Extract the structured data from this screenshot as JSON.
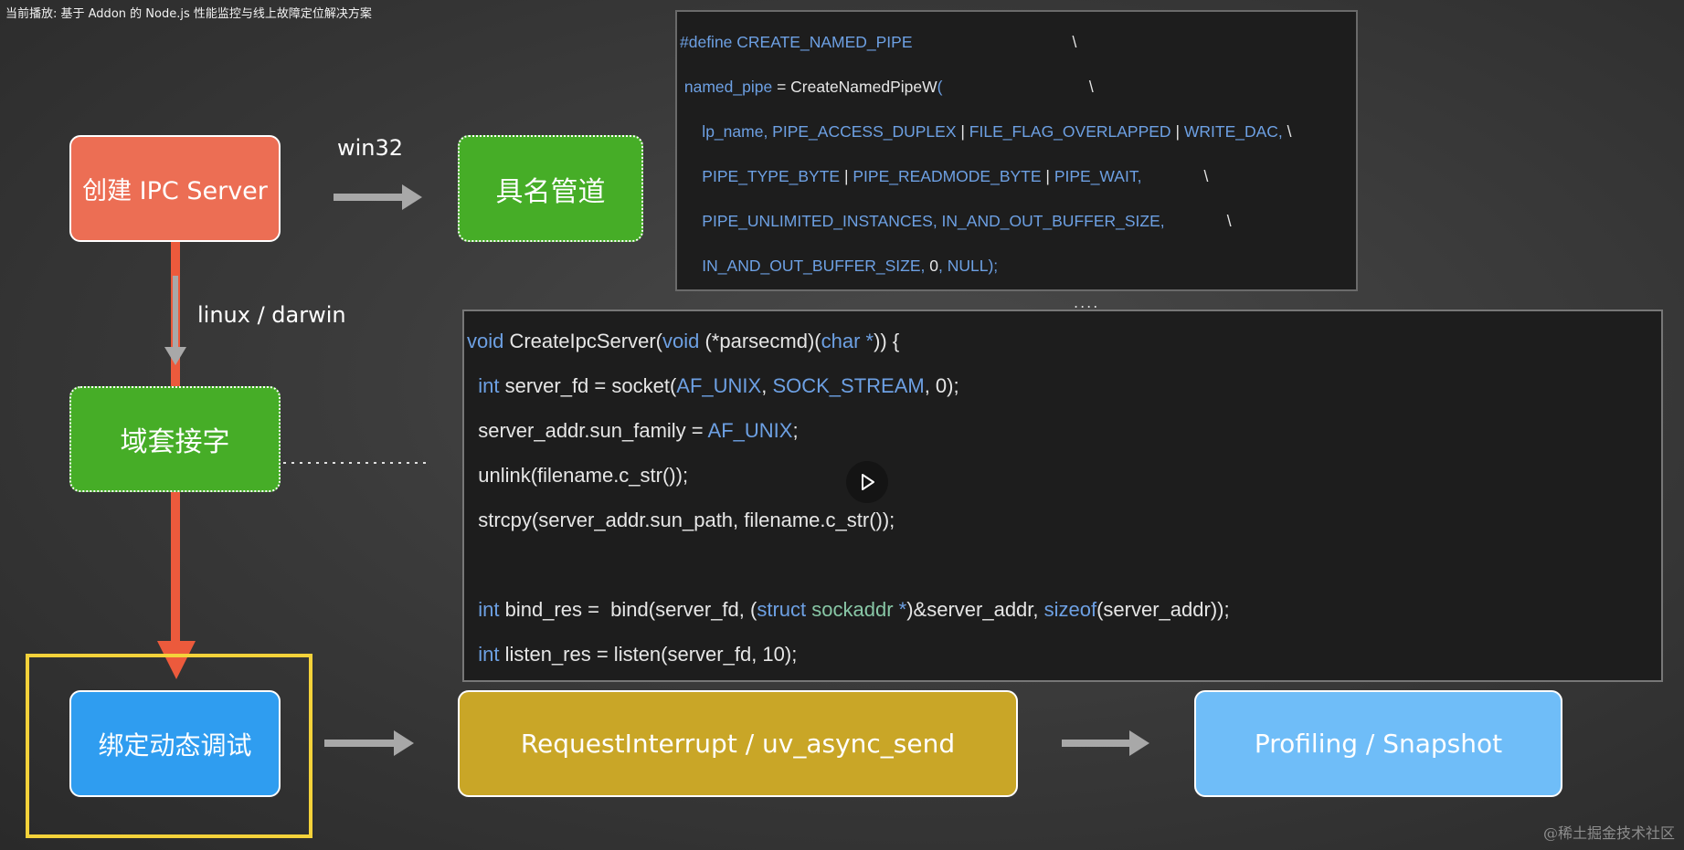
{
  "now_playing": "当前播放: 基于 Addon 的 Node.js 性能监控与线上故障定位解决方案",
  "watermark": "@稀土掘金技术社区",
  "flow": {
    "create_server": "创建 IPC Server",
    "named_pipe": "具名管道",
    "domain_socket": "域套接字",
    "bind_debug": "绑定动态调试",
    "request_interrupt": "RequestInterrupt / uv_async_send",
    "profiling": "Profiling / Snapshot",
    "label_win32": "win32",
    "label_linux": "linux / darwin"
  },
  "code_win": {
    "line1": [
      {
        "t": "#define ",
        "c": "kw"
      },
      {
        "t": "CREATE_NAMED_PIPE",
        "c": "kw"
      },
      {
        "t": "                                    \\",
        "c": "fn"
      }
    ],
    "line2": [
      {
        "t": " named_pipe",
        "c": "kw"
      },
      {
        "t": " = CreateNamedPipeW",
        "c": "fn"
      },
      {
        "t": "(",
        "c": "kw"
      },
      {
        "t": "                                 \\",
        "c": "fn"
      }
    ],
    "line3": [
      {
        "t": "     lp_name, PIPE_ACCESS_DUPLEX",
        "c": "kw"
      },
      {
        "t": " | ",
        "c": "fn"
      },
      {
        "t": "FILE_FLAG_OVERLAPPED",
        "c": "kw"
      },
      {
        "t": " | ",
        "c": "fn"
      },
      {
        "t": "WRITE_DAC,",
        "c": "kw"
      },
      {
        "t": " \\",
        "c": "fn"
      }
    ],
    "line4": [
      {
        "t": "     PIPE_TYPE_BYTE",
        "c": "kw"
      },
      {
        "t": " | ",
        "c": "fn"
      },
      {
        "t": "PIPE_READMODE_BYTE",
        "c": "kw"
      },
      {
        "t": " | ",
        "c": "fn"
      },
      {
        "t": "PIPE_WAIT,",
        "c": "kw"
      },
      {
        "t": "              \\",
        "c": "fn"
      }
    ],
    "line5": [
      {
        "t": "     PIPE_UNLIMITED_INSTANCES, IN_AND_OUT_BUFFER_SIZE,",
        "c": "kw"
      },
      {
        "t": "              \\",
        "c": "fn"
      }
    ],
    "line6": [
      {
        "t": "     IN_AND_OUT_BUFFER_SIZE, ",
        "c": "kw"
      },
      {
        "t": "0",
        "c": "fn"
      },
      {
        "t": ", NULL);",
        "c": "kw"
      }
    ]
  },
  "code_unix": {
    "line1": [
      {
        "t": "void",
        "c": "kw"
      },
      {
        "t": " CreateIpcServer(",
        "c": "fn"
      },
      {
        "t": "void",
        "c": "kw"
      },
      {
        "t": " (*parsecmd)(",
        "c": "fn"
      },
      {
        "t": "char",
        "c": "kw"
      },
      {
        "t": " *",
        "c": "kw"
      },
      {
        "t": ")) {",
        "c": "fn"
      }
    ],
    "line2": [
      {
        "t": "  int",
        "c": "kw"
      },
      {
        "t": " server_fd = socket(",
        "c": "fn"
      },
      {
        "t": "AF_UNIX",
        "c": "kw"
      },
      {
        "t": ", ",
        "c": "fn"
      },
      {
        "t": "SOCK_STREAM",
        "c": "kw"
      },
      {
        "t": ", 0);",
        "c": "fn"
      }
    ],
    "line3": [
      {
        "t": "  server_addr.sun_family = ",
        "c": "fn"
      },
      {
        "t": "AF_UNIX",
        "c": "kw"
      },
      {
        "t": ";",
        "c": "fn"
      }
    ],
    "line4": [
      {
        "t": "  unlink(filename.c_str());",
        "c": "fn"
      }
    ],
    "line5": [
      {
        "t": "  strcpy(server_addr.sun_path, filename.c_str());",
        "c": "fn"
      }
    ],
    "line6": [
      {
        "t": "  int",
        "c": "kw"
      },
      {
        "t": " bind_res =  bind(server_fd, (",
        "c": "fn"
      },
      {
        "t": "struct",
        "c": "kw"
      },
      {
        "t": " sockaddr",
        "c": "tp"
      },
      {
        "t": " *",
        "c": "kw"
      },
      {
        "t": ")&server_addr, ",
        "c": "fn"
      },
      {
        "t": "sizeof",
        "c": "kw"
      },
      {
        "t": "(server_addr));",
        "c": "fn"
      }
    ],
    "line7": [
      {
        "t": "  int",
        "c": "kw"
      },
      {
        "t": " listen_res = listen(server_fd, 10);",
        "c": "fn"
      }
    ]
  },
  "ellipsis": "....",
  "colors": {
    "red": "#ec6e54",
    "green": "#46ad27",
    "blue": "#2f9df0",
    "yellow": "#c9a627",
    "light_blue": "#6fbdf8",
    "highlight": "#f4d23a",
    "arrow_gray": "#a8a8a8",
    "arrow_red": "#ec5a3c"
  },
  "icons": {
    "play": "play-icon"
  }
}
